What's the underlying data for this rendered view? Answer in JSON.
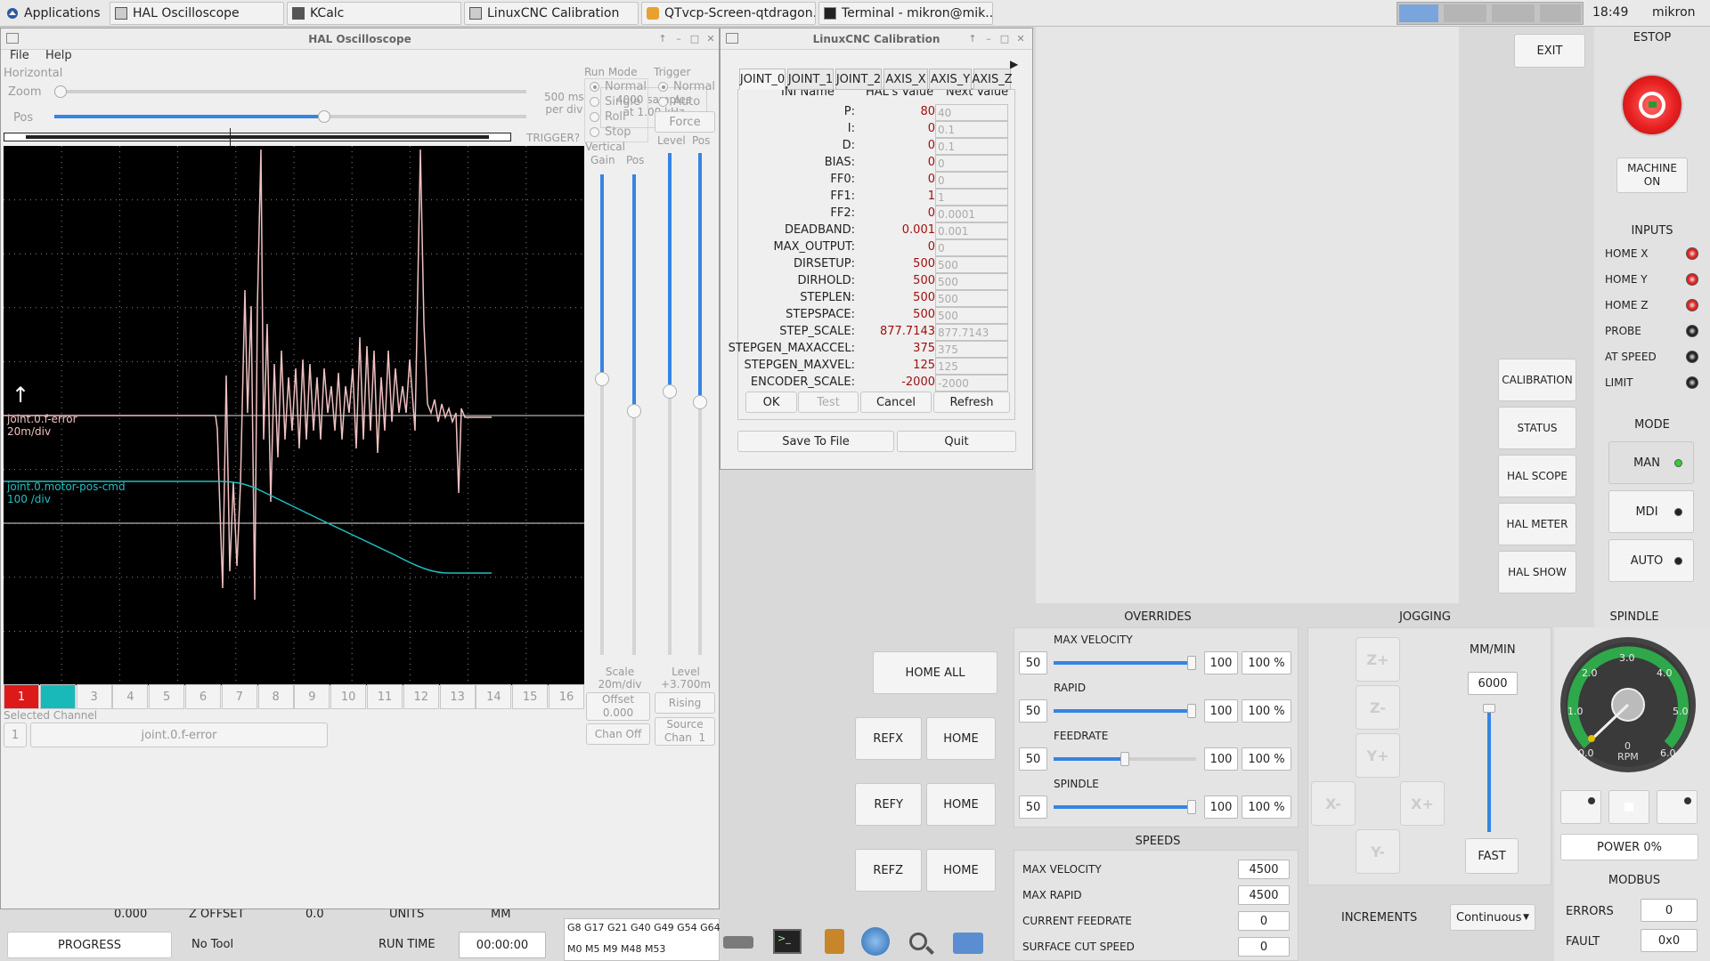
{
  "taskbar": {
    "apps_label": "Applications",
    "tasks": [
      "HAL Oscilloscope",
      "KCalc",
      "LinuxCNC Calibration",
      "QTvcp-Screen-qtdragon...",
      "Terminal - mikron@mik..."
    ],
    "clock": "18:49",
    "user": "mikron"
  },
  "scope": {
    "title": "HAL Oscilloscope",
    "menu": [
      "File",
      "Help"
    ],
    "horizontal_label": "Horizontal",
    "zoom_label": "Zoom",
    "pos_label": "Pos",
    "rate": "500 ms\nper div",
    "samples": "4000 samples\nat 1.00 kHz",
    "trigger_status": "TRIGGER?",
    "run_mode": {
      "label": "Run Mode",
      "options": [
        "Normal",
        "Single",
        "Roll",
        "Stop"
      ]
    },
    "trigger": {
      "label": "Trigger",
      "options": [
        "Normal",
        "Auto"
      ],
      "force": "Force",
      "level": "Level",
      "pos": "Pos"
    },
    "vertical": {
      "label": "Vertical",
      "gain": "Gain",
      "pos": "Pos"
    },
    "scale": "Scale\n20m/div",
    "offset": "Offset\n0.000",
    "chan_off": "Chan Off",
    "trig_level": "Level\n+3.700m",
    "rising": "Rising",
    "source": "Source\nChan  1",
    "channels": [
      "1",
      "2",
      "3",
      "4",
      "5",
      "6",
      "7",
      "8",
      "9",
      "10",
      "11",
      "12",
      "13",
      "14",
      "15",
      "16"
    ],
    "selected_channel_label": "Selected Channel",
    "selected_channel_num": "1",
    "selected_channel_name": "joint.0.f-error",
    "traces": [
      {
        "name": "joint.0.f-error",
        "scale": "20m/div",
        "color": "#f0c0c0"
      },
      {
        "name": "joint.0.motor-pos-cmd",
        "scale": "100 /div",
        "color": "#20c0c0"
      }
    ]
  },
  "calib": {
    "title": "LinuxCNC Calibration",
    "tabs": [
      "JOINT_0",
      "JOINT_1",
      "JOINT_2",
      "AXIS_X",
      "AXIS_Y",
      "AXIS_Z"
    ],
    "headers": [
      "INI Name",
      "HAL's Value",
      "Next Value"
    ],
    "rows": [
      {
        "name": "P:",
        "hal": "80",
        "next": "40"
      },
      {
        "name": "I:",
        "hal": "0",
        "next": "0.1"
      },
      {
        "name": "D:",
        "hal": "0",
        "next": "0.1"
      },
      {
        "name": "BIAS:",
        "hal": "0",
        "next": "0"
      },
      {
        "name": "FF0:",
        "hal": "0",
        "next": "0"
      },
      {
        "name": "FF1:",
        "hal": "1",
        "next": "1"
      },
      {
        "name": "FF2:",
        "hal": "0",
        "next": "0.0001"
      },
      {
        "name": "DEADBAND:",
        "hal": "0.001",
        "next": "0.001"
      },
      {
        "name": "MAX_OUTPUT:",
        "hal": "0",
        "next": "0"
      },
      {
        "name": "DIRSETUP:",
        "hal": "500",
        "next": "500"
      },
      {
        "name": "DIRHOLD:",
        "hal": "500",
        "next": "500"
      },
      {
        "name": "STEPLEN:",
        "hal": "500",
        "next": "500"
      },
      {
        "name": "STEPSPACE:",
        "hal": "500",
        "next": "500"
      },
      {
        "name": "STEP_SCALE:",
        "hal": "877.7143",
        "next": "877.7143"
      },
      {
        "name": "STEPGEN_MAXACCEL:",
        "hal": "375",
        "next": "375"
      },
      {
        "name": "STEPGEN_MAXVEL:",
        "hal": "125",
        "next": "125"
      },
      {
        "name": "ENCODER_SCALE:",
        "hal": "-2000",
        "next": "-2000"
      }
    ],
    "ok": "OK",
    "test": "Test",
    "cancel": "Cancel",
    "refresh": "Refresh",
    "save": "Save To File",
    "quit": "Quit"
  },
  "dragon": {
    "exit": "EXIT",
    "estop": "ESTOP",
    "machine_on": "MACHINE\nON",
    "inputs_label": "INPUTS",
    "inputs": [
      {
        "label": "HOME X",
        "color": "#e02020"
      },
      {
        "label": "HOME Y",
        "color": "#e02020"
      },
      {
        "label": "HOME Z",
        "color": "#e02020"
      },
      {
        "label": "PROBE",
        "color": "#222222"
      },
      {
        "label": "AT SPEED",
        "color": "#222222"
      },
      {
        "label": "LIMIT",
        "color": "#222222"
      }
    ],
    "side_buttons": [
      "CALIBRATION",
      "STATUS",
      "HAL SCOPE",
      "HAL METER",
      "HAL SHOW"
    ],
    "mode_label": "MODE",
    "modes": [
      {
        "label": "MAN",
        "led": "#30d030"
      },
      {
        "label": "MDI",
        "led": "#222222"
      },
      {
        "label": "AUTO",
        "led": "#222222"
      }
    ],
    "overrides_label": "OVERRIDES",
    "overrides": [
      {
        "label": "MAX VELOCITY",
        "min": "50",
        "max": "100",
        "pct": "100 %",
        "value": 1.0
      },
      {
        "label": "RAPID",
        "min": "50",
        "max": "100",
        "pct": "100 %",
        "value": 1.0
      },
      {
        "label": "FEEDRATE",
        "min": "50",
        "max": "100",
        "pct": "100 %",
        "value": 0.5
      },
      {
        "label": "SPINDLE",
        "min": "50",
        "max": "100",
        "pct": "100 %",
        "value": 1.0
      }
    ],
    "home_all": "HOME ALL",
    "ref": [
      "REFX",
      "REFY",
      "REFZ"
    ],
    "home": "HOME",
    "jogging_label": "JOGGING",
    "jog_buttons": [
      "Z+",
      "Z-",
      "Y+",
      "X-",
      "X+",
      "Y-"
    ],
    "jog_units": "MM/MIN",
    "jog_rate": "6000",
    "fast": "FAST",
    "increments_label": "INCREMENTS",
    "increments_value": "Continuous",
    "speeds_label": "SPEEDS",
    "speeds": [
      {
        "label": "MAX VELOCITY",
        "value": "4500"
      },
      {
        "label": "MAX RAPID",
        "value": "4500"
      },
      {
        "label": "CURRENT FEEDRATE",
        "value": "0"
      },
      {
        "label": "SURFACE CUT SPEED",
        "value": "0"
      }
    ],
    "spindle_label": "SPINDLE",
    "gauge_ticks": [
      "0.0",
      "1.0",
      "2.0",
      "3.0",
      "4.0",
      "5.0",
      "6.0"
    ],
    "gauge_value": "0",
    "gauge_unit": "RPM",
    "power": "POWER 0%",
    "modbus_label": "MODBUS",
    "errors_label": "ERRORS",
    "errors_value": "0",
    "fault_label": "FAULT",
    "fault_value": "0x0",
    "bottom": {
      "progress": "PROGRESS",
      "tool": "No Tool",
      "run_time_label": "RUN TIME",
      "run_time": "00:00:00",
      "gcodes": "G8 G17 G21 G40 G49 G54 G64",
      "mcodes": "M0 M5 M9 M48 M53",
      "partial_left": "0.000",
      "partial_offset": "Z OFFSET",
      "partial_zero": "0.0",
      "partial_units": "UNITS",
      "partial_mm": "MM"
    }
  }
}
